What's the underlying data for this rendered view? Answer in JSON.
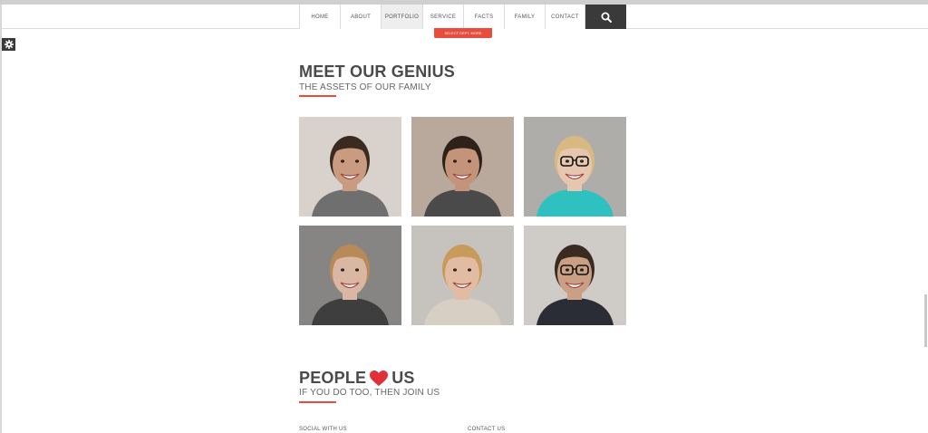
{
  "nav": {
    "items": [
      {
        "label": "HOME",
        "active": false
      },
      {
        "label": "ABOUT",
        "active": false
      },
      {
        "label": "PORTFOLIO",
        "active": true
      },
      {
        "label": "SERVICE",
        "active": false
      },
      {
        "label": "FACTS",
        "active": false
      },
      {
        "label": "FAMILY",
        "active": false
      },
      {
        "label": "CONTACT",
        "active": false
      }
    ],
    "search_icon": "search-icon"
  },
  "top_button": {
    "label": "SELECT DEPT. MORE"
  },
  "settings": {
    "icon": "gear-icon"
  },
  "team": {
    "title": "MEET OUR GENIUS",
    "subtitle": "THE ASSETS OF OUR FAMILY",
    "members": [
      {
        "bg": "#d9d2cc",
        "skin": "#c99b80",
        "hair": "#3b2a20",
        "shirt": "#6f6f6f",
        "glasses": false
      },
      {
        "bg": "#b9a99c",
        "skin": "#c3937a",
        "hair": "#2d211a",
        "shirt": "#4a4a4a",
        "glasses": false
      },
      {
        "bg": "#aeadaa",
        "skin": "#e7c6b0",
        "hair": "#d9b982",
        "shirt": "#2fc0c0",
        "glasses": true
      },
      {
        "bg": "#878583",
        "skin": "#d9b7a2",
        "hair": "#b88a5a",
        "shirt": "#3e3e3e",
        "glasses": false
      },
      {
        "bg": "#c6c3bf",
        "skin": "#e2bca2",
        "hair": "#c89b5c",
        "shirt": "#d8cfc4",
        "glasses": false
      },
      {
        "bg": "#cfcbc6",
        "skin": "#caa084",
        "hair": "#3a2b22",
        "shirt": "#2a2d35",
        "glasses": true
      }
    ]
  },
  "people": {
    "title_left": "PEOPLE",
    "title_right": "US",
    "heart_icon": "heart-icon",
    "subtitle": "IF YOU DO TOO, THEN JOIN US"
  },
  "footer": {
    "social_label": "SOCIAL WITH US",
    "contact_label": "CONTACT US"
  },
  "colors": {
    "accent": "#e74c3c",
    "dark": "#3a3a3a"
  }
}
